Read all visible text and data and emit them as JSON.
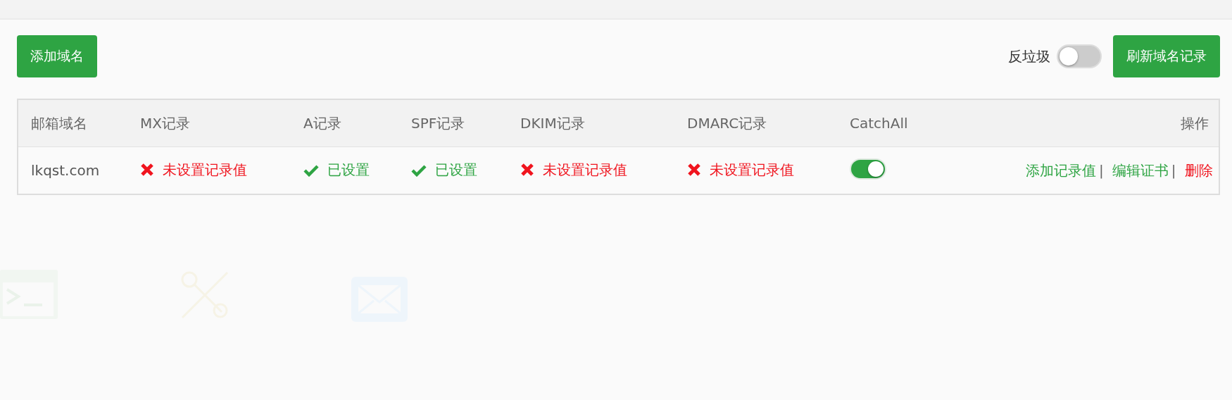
{
  "toolbar": {
    "add_button": "添加域名",
    "antispam": {
      "label": "反垃圾",
      "on": false
    },
    "refresh_button": "刷新域名记录"
  },
  "table": {
    "columns": [
      "邮箱域名",
      "MX记录",
      "A记录",
      "SPF记录",
      "DKIM记录",
      "DMARC记录",
      "CatchAll",
      "操作"
    ],
    "rows": [
      {
        "domain": "lkqst.com",
        "records": [
          {
            "ok": false,
            "text": "未设置记录值"
          },
          {
            "ok": true,
            "text": "已设置"
          },
          {
            "ok": true,
            "text": "已设置"
          },
          {
            "ok": false,
            "text": "未设置记录值"
          },
          {
            "ok": false,
            "text": "未设置记录值"
          }
        ],
        "catchall_on": true,
        "separator": "|",
        "actions": [
          {
            "kind": "link",
            "label": "添加记录值"
          },
          {
            "kind": "link",
            "label": "编辑证书"
          },
          {
            "kind": "danger",
            "label": "删除"
          }
        ]
      }
    ]
  }
}
